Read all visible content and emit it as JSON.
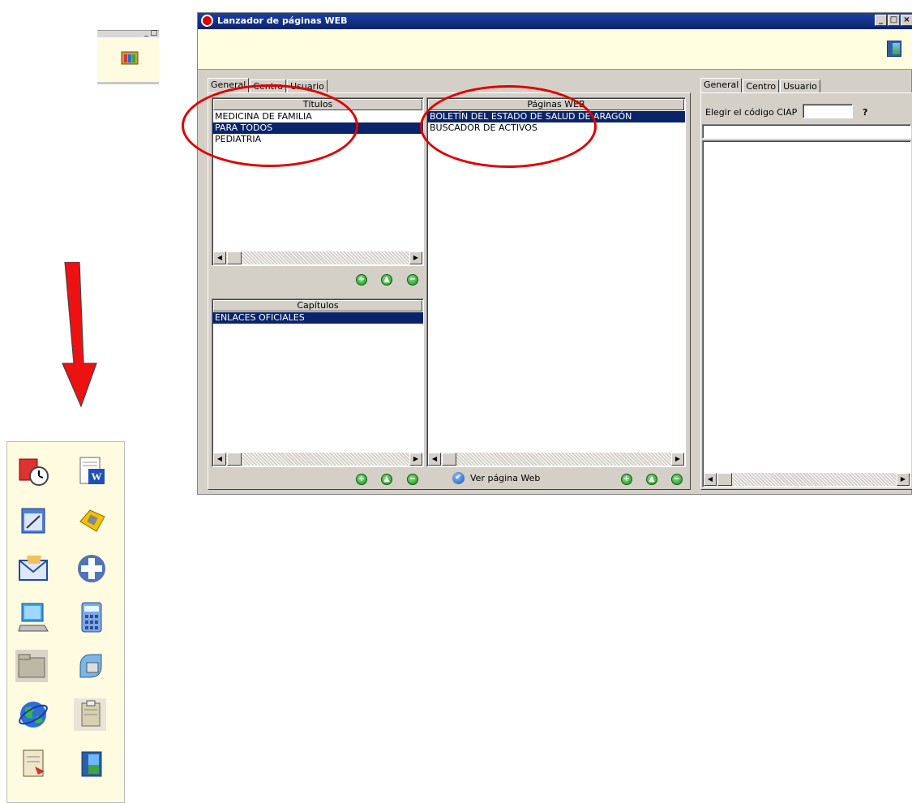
{
  "window": {
    "title": "Lanzador de páginas WEB",
    "controls": [
      "_",
      "□",
      "×"
    ]
  },
  "left_tabs": [
    "General",
    "Centro",
    "Usuario"
  ],
  "right_tabs": [
    "General",
    "Centro",
    "Usuario"
  ],
  "titulos": {
    "header": "Títulos",
    "items": [
      {
        "label": "MEDICINA DE FAMILIA",
        "selected": false
      },
      {
        "label": "PARA TODOS",
        "selected": true
      },
      {
        "label": "PEDIATRIA",
        "selected": false
      }
    ]
  },
  "capitulos": {
    "header": "Capítulos",
    "items": [
      {
        "label": "ENLACES OFICIALES",
        "selected": true
      }
    ]
  },
  "paginas": {
    "header": "Páginas WEB",
    "items": [
      {
        "label": "BOLETÍN DEL ESTADO DE SALUD DE ARAGÓN",
        "selected": true
      },
      {
        "label": "BUSCADOR DE ACTIVOS",
        "selected": false
      }
    ]
  },
  "ver_pagina_label": "Ver página Web",
  "ciap": {
    "label": "Elegir el código CIAP",
    "value": "",
    "help": "?"
  },
  "buttons": {
    "add": "+",
    "up": "▲",
    "remove": "−"
  },
  "colors": {
    "selection": "#0a246a",
    "annotation": "#e00000",
    "toolbar_bg": "#fffbe0"
  },
  "left_toolbar_icons": [
    "calendar-clock-icon",
    "word-document-icon",
    "notepad-icon",
    "telephone-icon",
    "mail-icon",
    "medical-cross-icon",
    "computer-icon",
    "calculator-icon",
    "folder-icon",
    "plug-icon",
    "globe-icon",
    "clipboard-icon",
    "scroll-icon",
    "exit-door-icon"
  ]
}
